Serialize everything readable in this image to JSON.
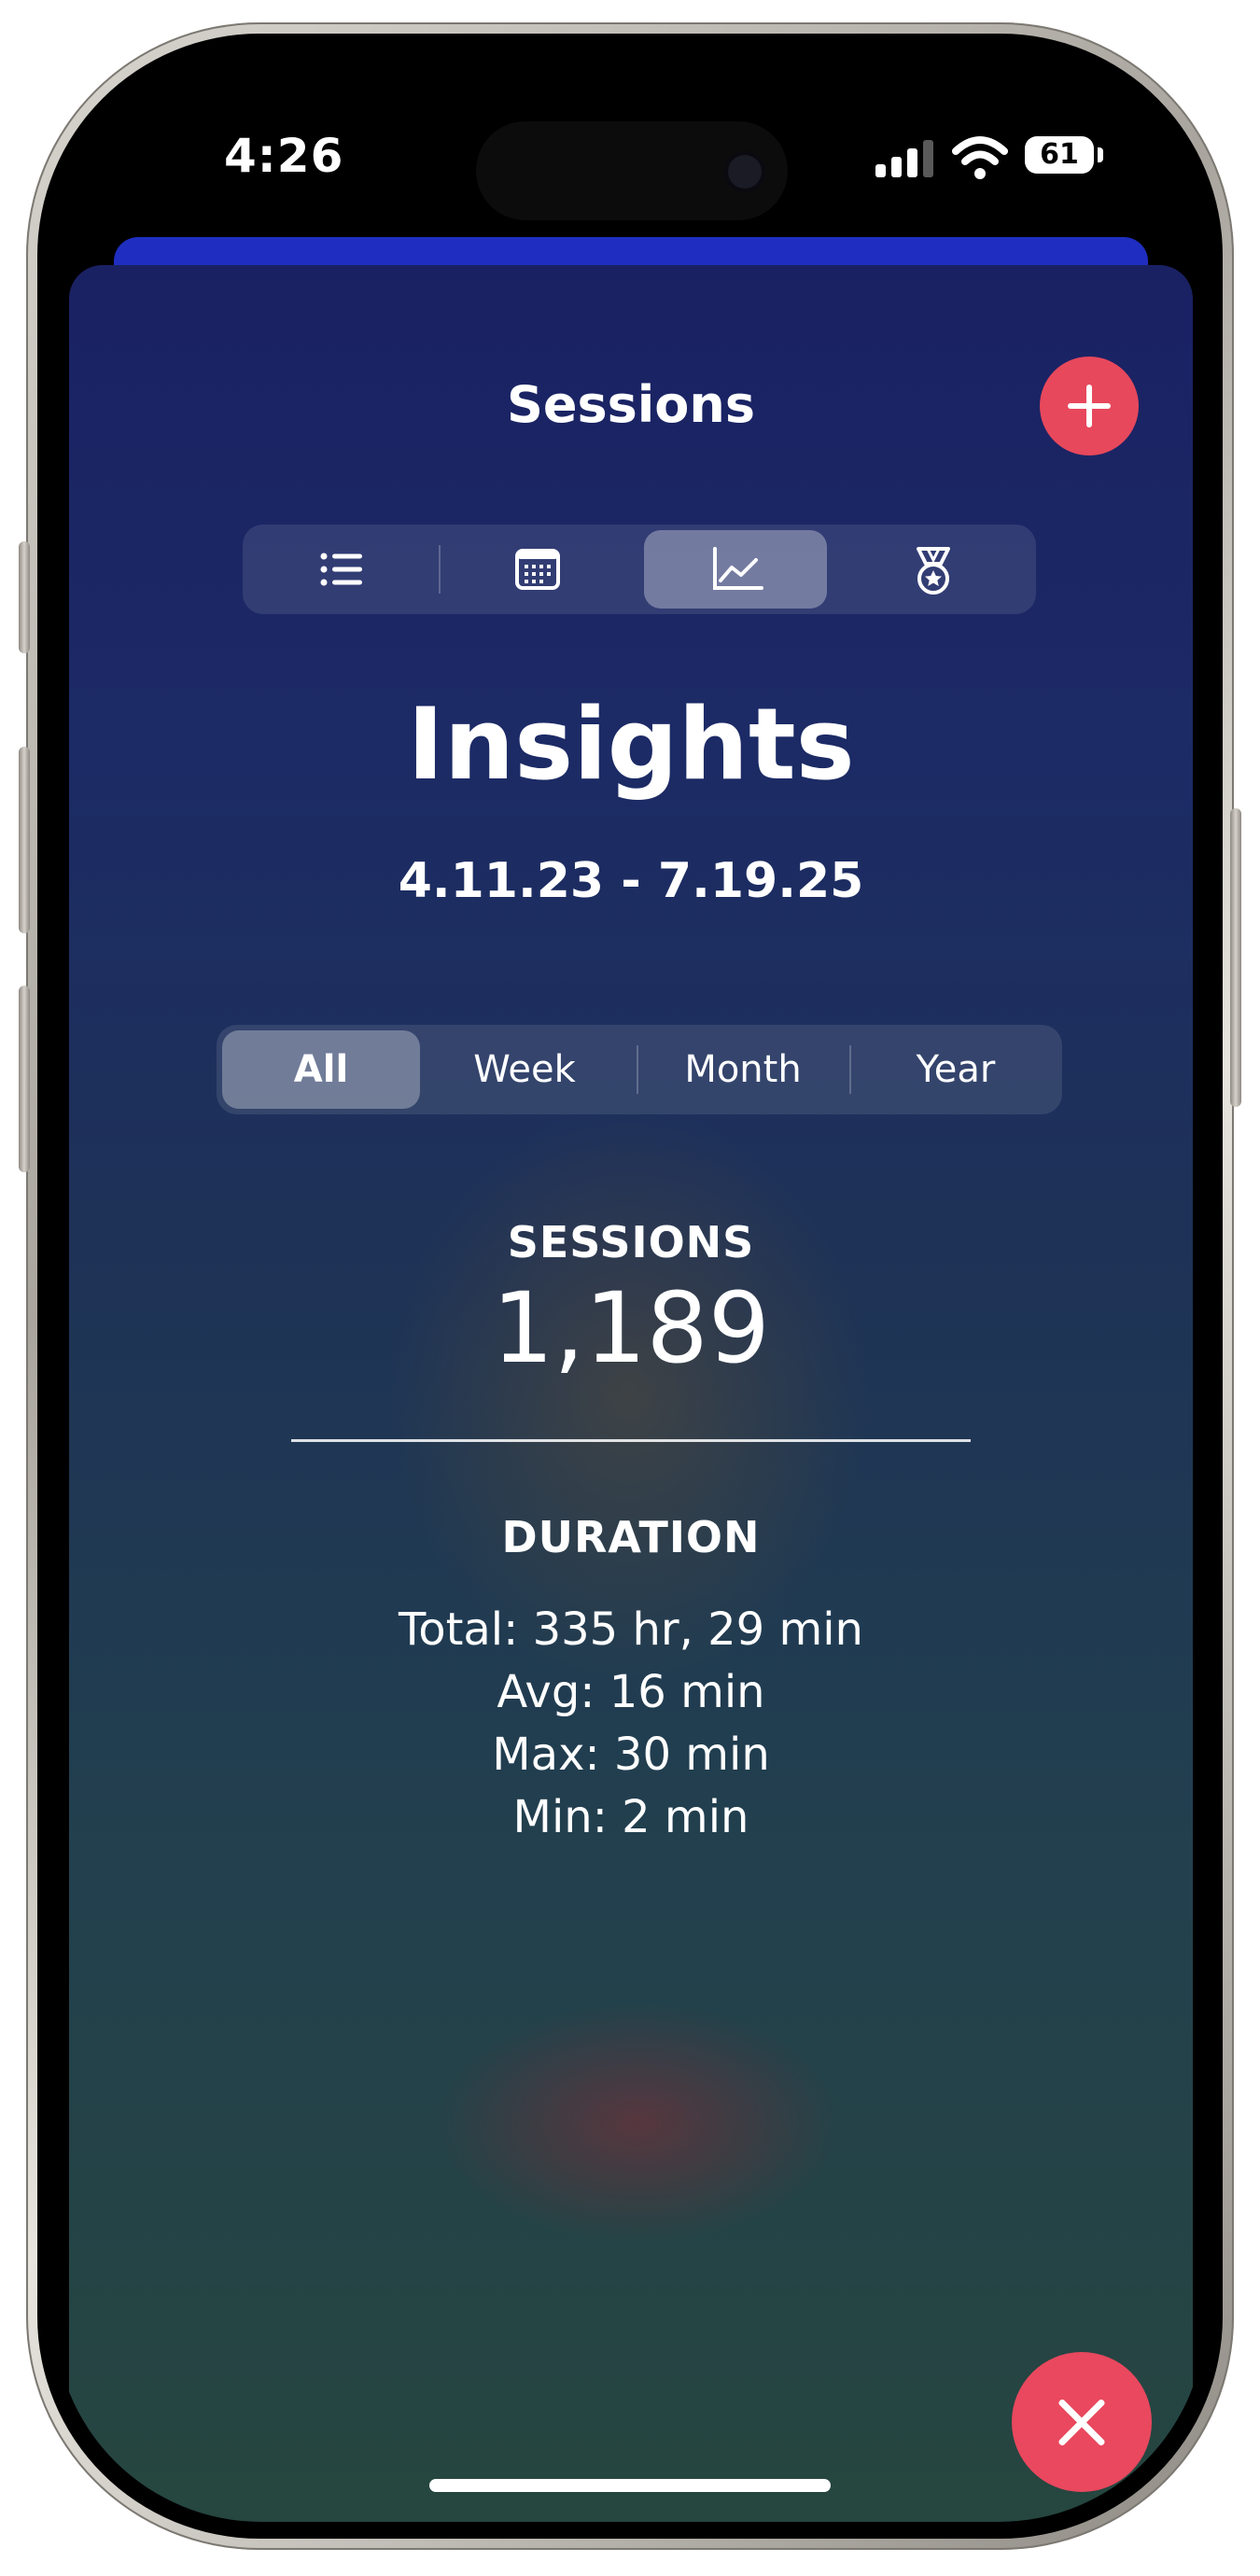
{
  "status_bar": {
    "time": "4:26",
    "battery": "61"
  },
  "header": {
    "title": "Sessions"
  },
  "view_tabs": [
    {
      "icon": "list-icon"
    },
    {
      "icon": "calendar-icon"
    },
    {
      "icon": "chart-icon",
      "selected": true
    },
    {
      "icon": "medal-icon"
    }
  ],
  "insights": {
    "title": "Insights",
    "date_range": "4.11.23 - 7.19.25"
  },
  "period_tabs": [
    {
      "label": "All",
      "selected": true
    },
    {
      "label": "Week"
    },
    {
      "label": "Month"
    },
    {
      "label": "Year"
    }
  ],
  "sessions": {
    "label": "SESSIONS",
    "value": "1,189"
  },
  "duration": {
    "label": "DURATION",
    "total": "Total: 335 hr, 29 min",
    "avg": "Avg: 16 min",
    "max": "Max: 30 min",
    "min": "Min: 2 min"
  },
  "colors": {
    "accent": "#e7485c",
    "sheet_top": "#1a2163",
    "sheet_bottom": "#26463f"
  }
}
